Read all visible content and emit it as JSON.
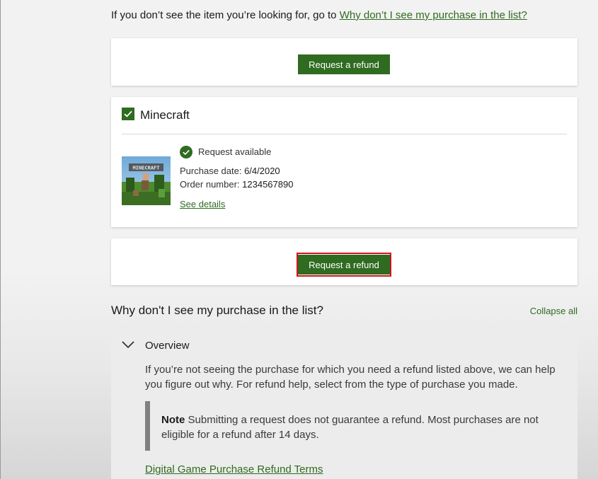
{
  "intro": {
    "text": "If you don’t see the item you’re looking for, go to ",
    "link": "Why don’t I see my purchase in the list?"
  },
  "refund_button_label": "Request a refund",
  "item": {
    "title": "Minecraft",
    "checked": true,
    "status": "Request available",
    "purchase_date_label": "Purchase date: ",
    "purchase_date": "6/4/2020",
    "order_number_label": "Order number: ",
    "order_number": "1234567890",
    "see_details": "See details",
    "thumbnail_logo": "MINECRAFT"
  },
  "section": {
    "heading": "Why don't I see my purchase in the list?",
    "collapse_all": "Collapse all"
  },
  "overview": {
    "title": "Overview",
    "body": "If you’re not seeing the purchase for which you need a refund listed above, we can help you figure out why. For refund help, select from the type of purchase you made.",
    "note_label": "Note",
    "note_text": " Submitting a request does not guarantee a refund. Most purchases are not eligible for a refund after 14 days.",
    "terms_link": "Digital Game Purchase Refund Terms"
  },
  "colors": {
    "accent": "#2f6b20",
    "highlight": "#d3121c"
  },
  "icons": {
    "checkbox": "checkmark-icon",
    "status": "check-circle-icon",
    "expand": "chevron-down-icon"
  }
}
